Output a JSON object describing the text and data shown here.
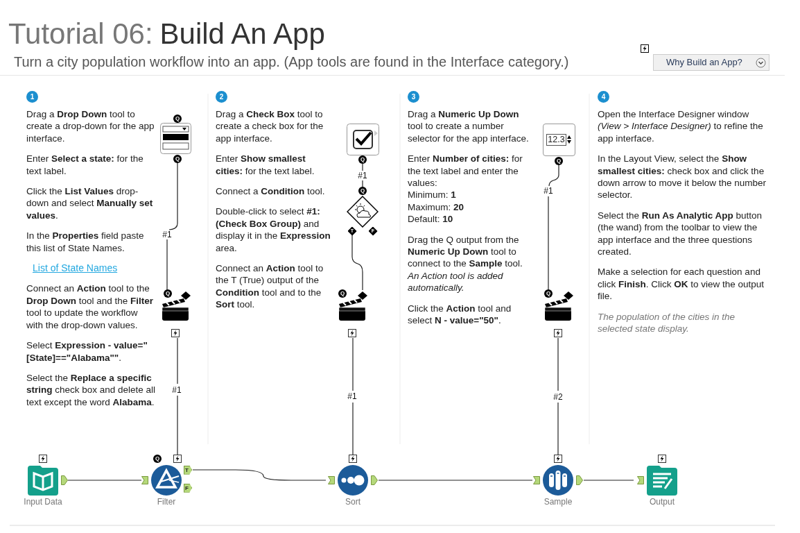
{
  "title": {
    "prefix": "Tutorial 06:",
    "main": "Build An App"
  },
  "subtitle": "Turn a city population workflow into an app. (App tools are found in the Interface category.)",
  "help_button": {
    "label": "Why Build an App?"
  },
  "steps": [
    {
      "number": "1",
      "paragraphs": [
        {
          "kind": "text",
          "text": "Drag a **Drop Down** tool to create a drop-down for the app interface."
        },
        {
          "kind": "text",
          "text": "Enter **Select a state:** for the text label."
        },
        {
          "kind": "text",
          "text": "Click the **List Values** drop-down and select **Manually set values**."
        },
        {
          "kind": "text",
          "text": "In the **Properties** field paste this list of State Names."
        },
        {
          "kind": "link",
          "text": "List of State Names"
        },
        {
          "kind": "text",
          "text": "Connect an **Action** tool to the **Drop Down** tool and the **Filter** tool to update the workflow with the drop-down values."
        },
        {
          "kind": "text",
          "text": "Select **Expression - value=\"[State]==\"Alabama\"\"**."
        },
        {
          "kind": "text",
          "text": "Select the **Replace a specific string** check box and delete all text except the word **Alabama**."
        }
      ]
    },
    {
      "number": "2",
      "paragraphs": [
        {
          "kind": "text",
          "text": "Drag a **Check Box** tool to create a check box for the app interface."
        },
        {
          "kind": "text",
          "text": "Enter **Show smallest cities:** for the text label."
        },
        {
          "kind": "text",
          "text": "Connect a **Condition** tool."
        },
        {
          "kind": "text",
          "text": "Double-click to select **#1: (Check Box Group)** and display it in the **Expression** area."
        },
        {
          "kind": "text",
          "text": "Connect an **Action** tool to the T (True) output of the **Condition** tool and to the **Sort** tool."
        }
      ]
    },
    {
      "number": "3",
      "paragraphs": [
        {
          "kind": "text",
          "text": "Drag a **Numeric Up Down** tool to create a number selector for the app interface."
        },
        {
          "kind": "lines",
          "lines": [
            "Enter **Number of cities:** for the text label and enter the values:",
            "Minimum: **1**",
            "Maximum: **20**",
            "Default: **10**"
          ]
        },
        {
          "kind": "text",
          "text": "Drag the Q output from the **Numeric Up Down** tool to connect to the **Sample** tool. *An Action tool is added automatically.*"
        },
        {
          "kind": "text",
          "text": "Click the **Action** tool and select **N - value=\"50\"**."
        }
      ]
    },
    {
      "number": "4",
      "paragraphs": [
        {
          "kind": "text",
          "text": "Open the Interface Designer window *(View > Interface Designer)* to refine the app interface."
        },
        {
          "kind": "text",
          "text": "In the Layout View, select the **Show smallest cities:** check box and click the down arrow to move it below the number selector."
        },
        {
          "kind": "text",
          "text": "Select the **Run As Analytic App** button (the wand) from the toolbar to view the app interface and the three questions created."
        },
        {
          "kind": "text",
          "text": "Make a selection for each question and click **Finish**. Click **OK** to view the output file."
        },
        {
          "kind": "note",
          "text": "The population of the cities in the selected state display."
        }
      ]
    }
  ],
  "canvas": {
    "interface_tools": [
      {
        "kind": "drop_down"
      },
      {
        "kind": "check_box"
      },
      {
        "kind": "condition"
      },
      {
        "kind": "numeric_up_down",
        "value": "12.3"
      },
      {
        "kind": "action"
      },
      {
        "kind": "action"
      },
      {
        "kind": "action"
      }
    ],
    "anchors": [
      {
        "kind": "circle",
        "letter": "Q"
      },
      {
        "kind": "circle",
        "letter": "Q"
      },
      {
        "kind": "circle",
        "letter": "Q"
      },
      {
        "kind": "circle",
        "letter": "Q"
      },
      {
        "kind": "circle",
        "letter": "Q"
      },
      {
        "kind": "diamond",
        "letter": "T"
      },
      {
        "kind": "diamond",
        "letter": "F"
      },
      {
        "kind": "circle",
        "letter": "Q"
      },
      {
        "kind": "circle",
        "letter": "Q"
      },
      {
        "kind": "circle",
        "letter": "Q"
      },
      {
        "kind": "circle",
        "letter": "Q"
      }
    ],
    "connection_labels": [
      "#1",
      "#1",
      "#1",
      "#1",
      "#1",
      "#2"
    ],
    "workflow_tools": [
      {
        "kind": "input",
        "label": "Input Data"
      },
      {
        "kind": "filter",
        "label": "Filter",
        "outputs": [
          "T",
          "F"
        ]
      },
      {
        "kind": "sort",
        "label": "Sort"
      },
      {
        "kind": "sample",
        "label": "Sample"
      },
      {
        "kind": "output",
        "label": "Output"
      }
    ]
  }
}
